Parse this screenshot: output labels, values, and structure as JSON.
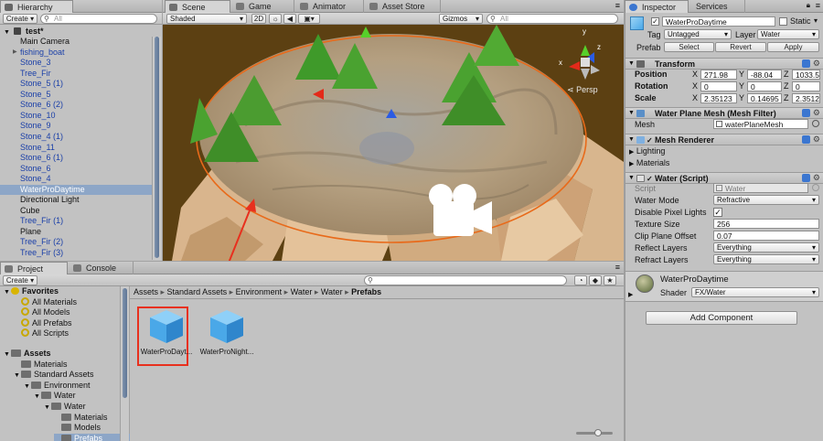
{
  "colors": {
    "accent_red": "#e8301e",
    "selection": "#8da6c7",
    "prefab_blue": "#1a3fa8",
    "water_cube": "#4aa8e8",
    "scene_bg": "#5a3f12"
  },
  "hierarchy": {
    "tab": "Hierarchy",
    "create_label": "Create",
    "search_placeholder": "All",
    "scene_name": "test*",
    "items": [
      {
        "label": "Main Camera",
        "prefab": false,
        "selected": false,
        "expander": false
      },
      {
        "label": "fishing_boat",
        "prefab": true,
        "selected": false,
        "expander": true
      },
      {
        "label": "Stone_3",
        "prefab": true,
        "selected": false,
        "expander": false
      },
      {
        "label": "Tree_Fir",
        "prefab": true,
        "selected": false,
        "expander": false
      },
      {
        "label": "Stone_5 (1)",
        "prefab": true,
        "selected": false,
        "expander": false
      },
      {
        "label": "Stone_5",
        "prefab": true,
        "selected": false,
        "expander": false
      },
      {
        "label": "Stone_6 (2)",
        "prefab": true,
        "selected": false,
        "expander": false
      },
      {
        "label": "Stone_10",
        "prefab": true,
        "selected": false,
        "expander": false
      },
      {
        "label": "Stone_9",
        "prefab": true,
        "selected": false,
        "expander": false
      },
      {
        "label": "Stone_4 (1)",
        "prefab": true,
        "selected": false,
        "expander": false
      },
      {
        "label": "Stone_11",
        "prefab": true,
        "selected": false,
        "expander": false
      },
      {
        "label": "Stone_6 (1)",
        "prefab": true,
        "selected": false,
        "expander": false
      },
      {
        "label": "Stone_6",
        "prefab": true,
        "selected": false,
        "expander": false
      },
      {
        "label": "Stone_4",
        "prefab": true,
        "selected": false,
        "expander": false
      },
      {
        "label": "WaterProDaytime",
        "prefab": false,
        "selected": true,
        "expander": false
      },
      {
        "label": "Directional Light",
        "prefab": false,
        "selected": false,
        "expander": false
      },
      {
        "label": "Cube",
        "prefab": false,
        "selected": false,
        "expander": false
      },
      {
        "label": "Tree_Fir (1)",
        "prefab": true,
        "selected": false,
        "expander": false
      },
      {
        "label": "Plane",
        "prefab": false,
        "selected": false,
        "expander": false
      },
      {
        "label": "Tree_Fir (2)",
        "prefab": true,
        "selected": false,
        "expander": false
      },
      {
        "label": "Tree_Fir (3)",
        "prefab": true,
        "selected": false,
        "expander": false
      }
    ]
  },
  "tabs": {
    "scene": "Scene",
    "game": "Game",
    "animator": "Animator",
    "asset_store": "Asset Store",
    "inspector": "Inspector",
    "services": "Services",
    "project": "Project",
    "console": "Console"
  },
  "scene": {
    "shading": "Shaded",
    "mode_2d": "2D",
    "gizmos": "Gizmos",
    "search_placeholder": "All",
    "persp": "Persp"
  },
  "inspector": {
    "object_name": "WaterProDaytime",
    "active": true,
    "static_label": "Static",
    "tag_label": "Tag",
    "tag_value": "Untagged",
    "layer_label": "Layer",
    "layer_value": "Water",
    "prefab_label": "Prefab",
    "prefab_select": "Select",
    "prefab_revert": "Revert",
    "prefab_apply": "Apply",
    "transform": {
      "title": "Transform",
      "position_label": "Position",
      "position": {
        "x": "271.98",
        "y": "-88.04",
        "z": "1033.59"
      },
      "rotation_label": "Rotation",
      "rotation": {
        "x": "0",
        "y": "0",
        "z": "0"
      },
      "scale_label": "Scale",
      "scale": {
        "x": "2.35123",
        "y": "0.14695",
        "z": "2.35123"
      },
      "x": "X",
      "y": "Y",
      "z": "Z"
    },
    "mesh_filter": {
      "title": "Water Plane Mesh (Mesh Filter)",
      "mesh_label": "Mesh",
      "mesh_value": "waterPlaneMesh"
    },
    "mesh_renderer": {
      "title": "Mesh Renderer",
      "lighting": "Lighting",
      "materials": "Materials"
    },
    "water_script": {
      "title": "Water (Script)",
      "script_label": "Script",
      "script_value": "Water",
      "water_mode_label": "Water Mode",
      "water_mode_value": "Refractive",
      "disable_pixel_lights_label": "Disable Pixel Lights",
      "disable_pixel_lights": true,
      "texture_size_label": "Texture Size",
      "texture_size": "256",
      "clip_plane_offset_label": "Clip Plane Offset",
      "clip_plane_offset": "0.07",
      "reflect_layers_label": "Reflect Layers",
      "reflect_layers": "Everything",
      "refract_layers_label": "Refract Layers",
      "refract_layers": "Everything"
    },
    "material": {
      "name": "WaterProDaytime",
      "shader_label": "Shader",
      "shader_value": "FX/Water"
    },
    "add_component": "Add Component"
  },
  "project": {
    "create_label": "Create",
    "breadcrumb": [
      "Assets",
      "Standard Assets",
      "Environment",
      "Water",
      "Water",
      "Prefabs"
    ],
    "tree": [
      {
        "label": "Favorites",
        "kind": "group",
        "indent": 0
      },
      {
        "label": "All Materials",
        "kind": "search",
        "indent": 1
      },
      {
        "label": "All Models",
        "kind": "search",
        "indent": 1
      },
      {
        "label": "All Prefabs",
        "kind": "search",
        "indent": 1
      },
      {
        "label": "All Scripts",
        "kind": "search",
        "indent": 1
      },
      {
        "label": "",
        "kind": "spacer",
        "indent": 0
      },
      {
        "label": "Assets",
        "kind": "group",
        "indent": 0
      },
      {
        "label": "Materials",
        "kind": "folder",
        "indent": 1
      },
      {
        "label": "Standard Assets",
        "kind": "folder-open",
        "indent": 1
      },
      {
        "label": "Environment",
        "kind": "folder-open",
        "indent": 2
      },
      {
        "label": "Water",
        "kind": "folder-open",
        "indent": 3
      },
      {
        "label": "Water",
        "kind": "folder-open",
        "indent": 4
      },
      {
        "label": "Materials",
        "kind": "folder",
        "indent": 5
      },
      {
        "label": "Models",
        "kind": "folder",
        "indent": 5
      },
      {
        "label": "Prefabs",
        "kind": "folder-selected",
        "indent": 5
      }
    ],
    "assets": [
      {
        "label": "WaterProDayt...",
        "highlighted": true
      },
      {
        "label": "WaterProNight...",
        "highlighted": false
      }
    ]
  }
}
